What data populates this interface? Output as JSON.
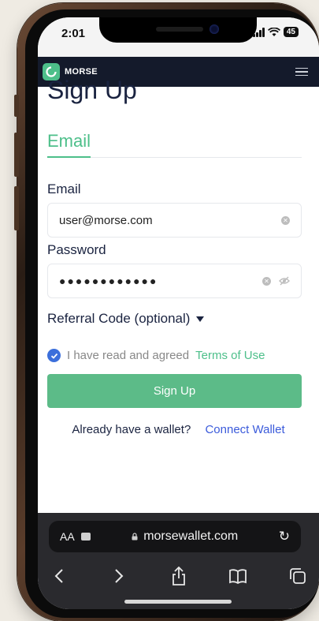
{
  "status_bar": {
    "time": "2:01",
    "battery": "45"
  },
  "header": {
    "brand": "MORSE"
  },
  "page": {
    "title": "Sign Up"
  },
  "tabs": [
    {
      "label": "Email",
      "active": true
    }
  ],
  "form": {
    "email_label": "Email",
    "email_value": "user@morse.com",
    "password_label": "Password",
    "password_value": "●●●●●●●●●●●●",
    "referral_label": "Referral Code (optional)",
    "agree_text": "I have read and agreed",
    "terms_link": "Terms of Use",
    "agree_checked": true,
    "signup_label": "Sign Up"
  },
  "footer": {
    "already_text": "Already have a wallet?",
    "connect_link": "Connect Wallet"
  },
  "browser": {
    "text_size_label": "AA",
    "url": "morsewallet.com",
    "toolbar_icons": [
      "back-icon",
      "forward-icon",
      "share-icon",
      "bookmarks-icon",
      "tabs-icon"
    ]
  },
  "colors": {
    "brand_green": "#4dbf8a",
    "header_bg": "#141a2b",
    "link_blue": "#3b5bdb",
    "title_navy": "#1a2340"
  }
}
